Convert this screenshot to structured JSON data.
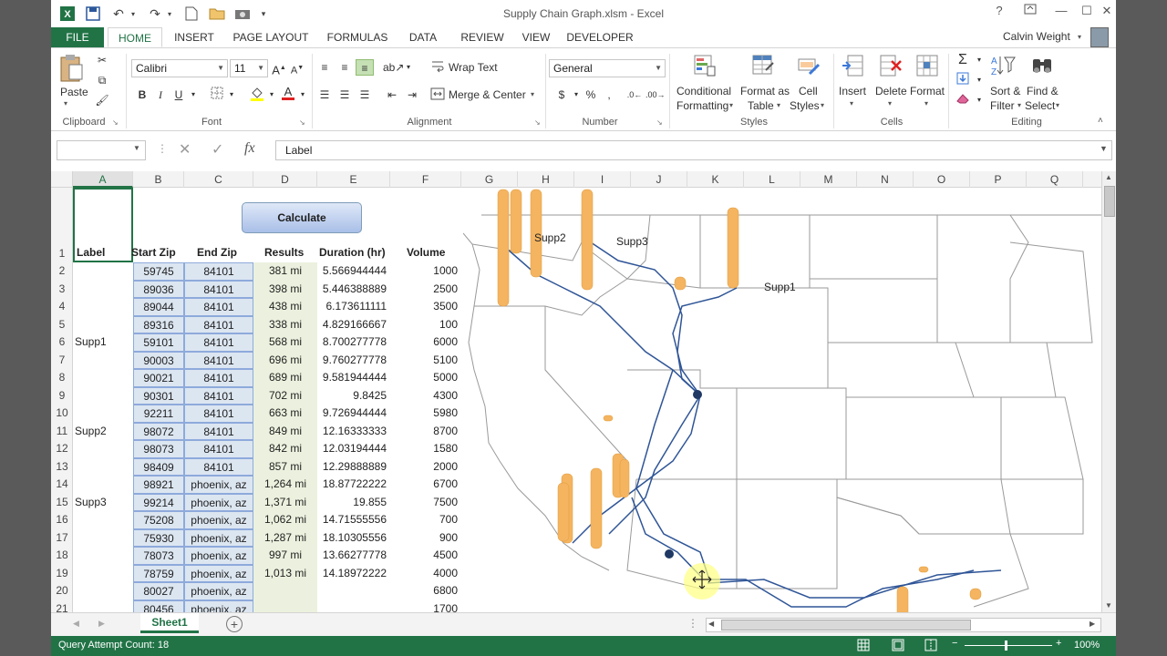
{
  "title_bar": {
    "window_title": "Supply Chain Graph.xlsm - Excel",
    "user_name": "Calvin Weight",
    "help_label": "?"
  },
  "tabs": [
    "FILE",
    "HOME",
    "INSERT",
    "PAGE LAYOUT",
    "FORMULAS",
    "DATA",
    "REVIEW",
    "VIEW",
    "DEVELOPER"
  ],
  "active_tab": "HOME",
  "ribbon": {
    "clipboard": {
      "label": "Clipboard",
      "paste": "Paste"
    },
    "font": {
      "label": "Font",
      "font_name": "Calibri",
      "font_size": "11"
    },
    "alignment": {
      "label": "Alignment",
      "wrap_text": "Wrap Text",
      "merge_center": "Merge & Center"
    },
    "number": {
      "label": "Number",
      "format": "General",
      "currency": "$",
      "percent": "%",
      "comma": ","
    },
    "styles": {
      "label": "Styles",
      "conditional": "Conditional",
      "conditional2": "Formatting",
      "format_as": "Format as",
      "format_as2": "Table",
      "cell": "Cell",
      "cell2": "Styles"
    },
    "cells": {
      "label": "Cells",
      "insert": "Insert",
      "delete": "Delete",
      "format": "Format"
    },
    "editing": {
      "label": "Editing",
      "sort": "Sort &",
      "sort2": "Filter",
      "find": "Find &",
      "find2": "Select"
    }
  },
  "formula_bar": {
    "name_box": "",
    "content": "Label",
    "fx": "fx"
  },
  "grid": {
    "columns": [
      "A",
      "B",
      "C",
      "D",
      "E",
      "F",
      "G",
      "H",
      "I",
      "J",
      "K",
      "L",
      "M",
      "N",
      "O",
      "P",
      "Q"
    ],
    "selected_column": "A",
    "row_numbers": [
      "1",
      "2",
      "3",
      "4",
      "5",
      "6",
      "7",
      "8",
      "9",
      "10",
      "11",
      "12",
      "13",
      "14",
      "15",
      "16",
      "17",
      "18",
      "19",
      "20",
      "21"
    ],
    "header_row": {
      "label": "Label",
      "start_zip": "Start Zip",
      "end_zip": "End Zip",
      "results": "Results",
      "duration": "Duration (hr)",
      "volume": "Volume"
    },
    "rows": [
      {
        "label": "",
        "start": "59745",
        "end": "84101",
        "result": "381 mi",
        "duration": "5.566944444",
        "volume": "1000"
      },
      {
        "label": "",
        "start": "89036",
        "end": "84101",
        "result": "398 mi",
        "duration": "5.446388889",
        "volume": "2500"
      },
      {
        "label": "",
        "start": "89044",
        "end": "84101",
        "result": "438 mi",
        "duration": "6.173611111",
        "volume": "3500"
      },
      {
        "label": "",
        "start": "89316",
        "end": "84101",
        "result": "338 mi",
        "duration": "4.829166667",
        "volume": "100"
      },
      {
        "label": "Supp1",
        "start": "59101",
        "end": "84101",
        "result": "568 mi",
        "duration": "8.700277778",
        "volume": "6000"
      },
      {
        "label": "",
        "start": "90003",
        "end": "84101",
        "result": "696 mi",
        "duration": "9.760277778",
        "volume": "5100"
      },
      {
        "label": "",
        "start": "90021",
        "end": "84101",
        "result": "689 mi",
        "duration": "9.581944444",
        "volume": "5000"
      },
      {
        "label": "",
        "start": "90301",
        "end": "84101",
        "result": "702 mi",
        "duration": "9.8425",
        "volume": "4300"
      },
      {
        "label": "",
        "start": "92211",
        "end": "84101",
        "result": "663 mi",
        "duration": "9.726944444",
        "volume": "5980"
      },
      {
        "label": "Supp2",
        "start": "98072",
        "end": "84101",
        "result": "849 mi",
        "duration": "12.16333333",
        "volume": "8700"
      },
      {
        "label": "",
        "start": "98073",
        "end": "84101",
        "result": "842 mi",
        "duration": "12.03194444",
        "volume": "1580"
      },
      {
        "label": "",
        "start": "98409",
        "end": "84101",
        "result": "857 mi",
        "duration": "12.29888889",
        "volume": "2000"
      },
      {
        "label": "",
        "start": "98921",
        "end": "phoenix, az",
        "result": "1,264 mi",
        "duration": "18.87722222",
        "volume": "6700"
      },
      {
        "label": "Supp3",
        "start": "99214",
        "end": "phoenix, az",
        "result": "1,371 mi",
        "duration": "19.855",
        "volume": "7500"
      },
      {
        "label": "",
        "start": "75208",
        "end": "phoenix, az",
        "result": "1,062 mi",
        "duration": "14.71555556",
        "volume": "700"
      },
      {
        "label": "",
        "start": "75930",
        "end": "phoenix, az",
        "result": "1,287 mi",
        "duration": "18.10305556",
        "volume": "900"
      },
      {
        "label": "",
        "start": "78073",
        "end": "phoenix, az",
        "result": "997 mi",
        "duration": "13.66277778",
        "volume": "4500"
      },
      {
        "label": "",
        "start": "78759",
        "end": "phoenix, az",
        "result": "1,013 mi",
        "duration": "14.18972222",
        "volume": "4000"
      },
      {
        "label": "",
        "start": "80027",
        "end": "phoenix, az",
        "result": "",
        "duration": "",
        "volume": "6800"
      },
      {
        "label": "",
        "start": "80456",
        "end": "phoenix, az",
        "result": "",
        "duration": "",
        "volume": "1700"
      }
    ]
  },
  "calculate_button": "Calculate",
  "map": {
    "labels": {
      "supp1": "Supp1",
      "supp2": "Supp2",
      "supp3": "Supp3"
    }
  },
  "sheets": [
    "Sheet1"
  ],
  "active_sheet": "Sheet1",
  "status_bar": {
    "message": "Query Attempt Count: 18",
    "zoom": "100%"
  },
  "colors": {
    "excel_green": "#217346",
    "route_blue": "#2f5597",
    "bar_orange": "#f4b460",
    "point_navy": "#1f3864"
  }
}
